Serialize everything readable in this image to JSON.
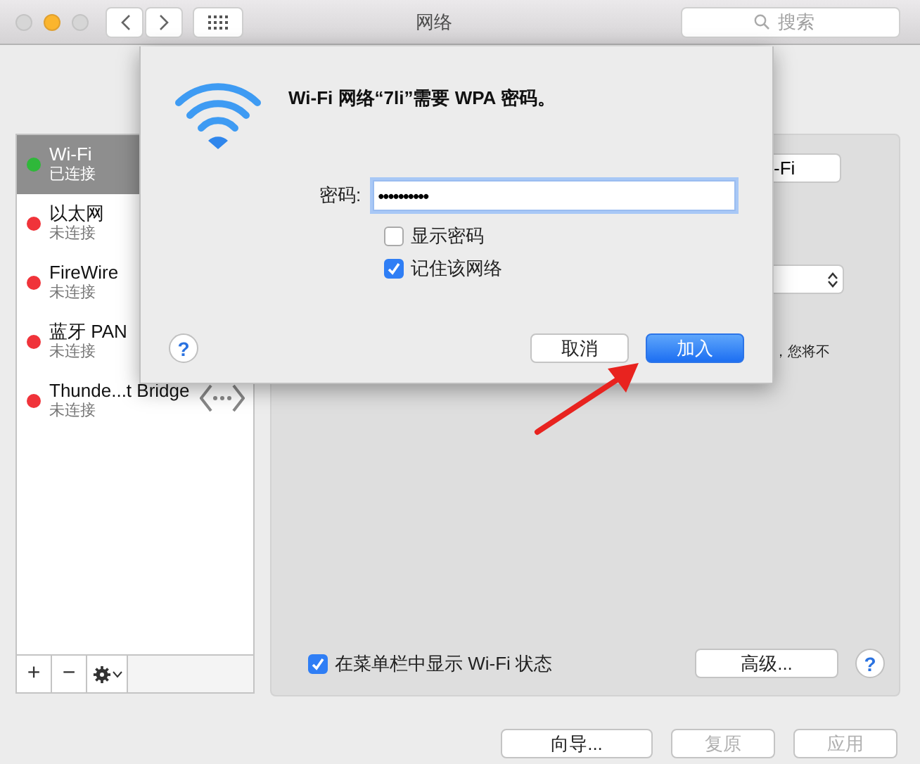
{
  "window": {
    "title": "网络",
    "search": {
      "placeholder": "搜索"
    }
  },
  "sidebar": {
    "items": [
      {
        "name": "Wi-Fi",
        "status": "已连接",
        "selected": true,
        "color": "#2fb83a",
        "kind": "interface"
      },
      {
        "name": "以太网",
        "status": "未连接",
        "selected": false,
        "color": "#f0333a",
        "kind": "interface"
      },
      {
        "name": "FireWire",
        "status": "未连接",
        "selected": false,
        "color": "#f0333a",
        "kind": "interface"
      },
      {
        "name": "蓝牙 PAN",
        "status": "未连接",
        "selected": false,
        "color": "#f0333a",
        "kind": "interface"
      },
      {
        "name": "Thunde...t Bridge",
        "status": "未连接",
        "selected": false,
        "color": "#f0333a",
        "kind": "bridge"
      }
    ],
    "toolbar": [
      "+",
      "−"
    ]
  },
  "panel": {
    "behind_sheet": [
      {
        "kind": "button",
        "text": "-Fi"
      },
      {
        "kind": "select"
      },
      {
        "kind": "text",
        "text": "，您将不"
      }
    ],
    "show_wifi_status": {
      "label": "在菜单栏中显示 Wi-Fi 状态",
      "checked": true
    },
    "advanced_button": "高级...",
    "help": "?"
  },
  "footer_buttons": [
    {
      "label": "向导...",
      "disabled": false
    },
    {
      "label": "复原",
      "disabled": true
    },
    {
      "label": "应用",
      "disabled": true
    }
  ],
  "sheet": {
    "title": "Wi-Fi 网络“7li”需要 WPA 密码。",
    "password_label": "密码:",
    "password_value": "••••••••••",
    "checkboxes": [
      {
        "label": "显示密码",
        "checked": false
      },
      {
        "label": "记住该网络",
        "checked": true
      }
    ],
    "help": "?",
    "buttons": [
      {
        "label": "取消",
        "default": false
      },
      {
        "label": "加入",
        "default": true
      }
    ]
  }
}
